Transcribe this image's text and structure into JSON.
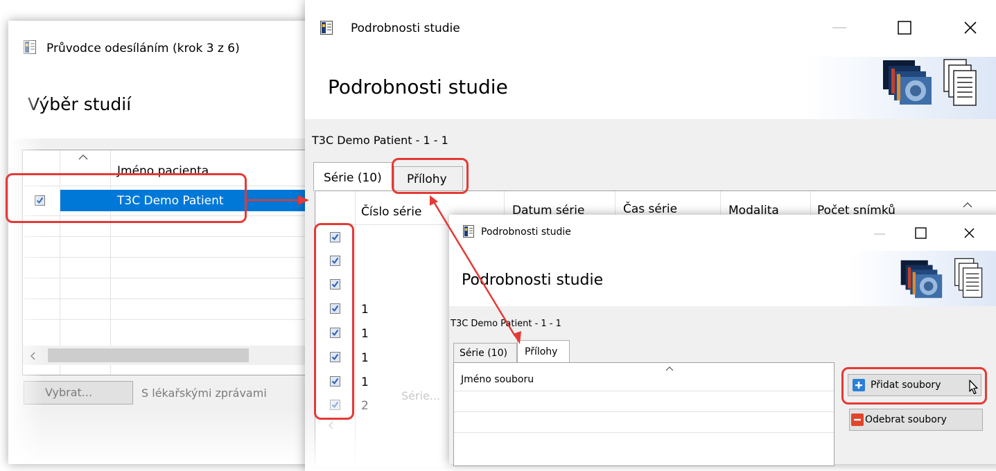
{
  "wizard": {
    "title": "Průvodce odesíláním (krok 3 z 6)",
    "header_title": "Výběr studií",
    "column_patient": "Jméno pacienta",
    "row_patient": "T3C Demo Patient",
    "select_button": "Vybrat...",
    "with_reports_label": "S lékařskými zprávami"
  },
  "details": {
    "title": "Podrobnosti studie",
    "header_title": "Podrobnosti studie",
    "study_label": "T3C Demo Patient - 1 - 1",
    "tab_series": "Série (10)",
    "tab_attachments": "Přílohy",
    "columns": [
      "Číslo série",
      "Datum série",
      "Čas série",
      "Modalita",
      "Počet snímků"
    ],
    "series_numbers": [
      "",
      "",
      "",
      "1",
      "1",
      "1",
      "1",
      "2"
    ],
    "faded_label": "Série..."
  },
  "attachments": {
    "title": "Podrobnosti studie",
    "header_title": "Podrobnosti studie",
    "study_label": "T3C Demo Patient - 1 - 1",
    "tab_series": "Série (10)",
    "tab_attachments": "Přílohy",
    "column_filename": "Jméno souboru",
    "add_button": "Přidat soubory",
    "remove_button": "Odebrat soubory"
  },
  "colors": {
    "selection": "#0078d7",
    "highlight": "#e53935",
    "add_icon": "#2a7fd6",
    "remove_icon": "#e0452b"
  }
}
